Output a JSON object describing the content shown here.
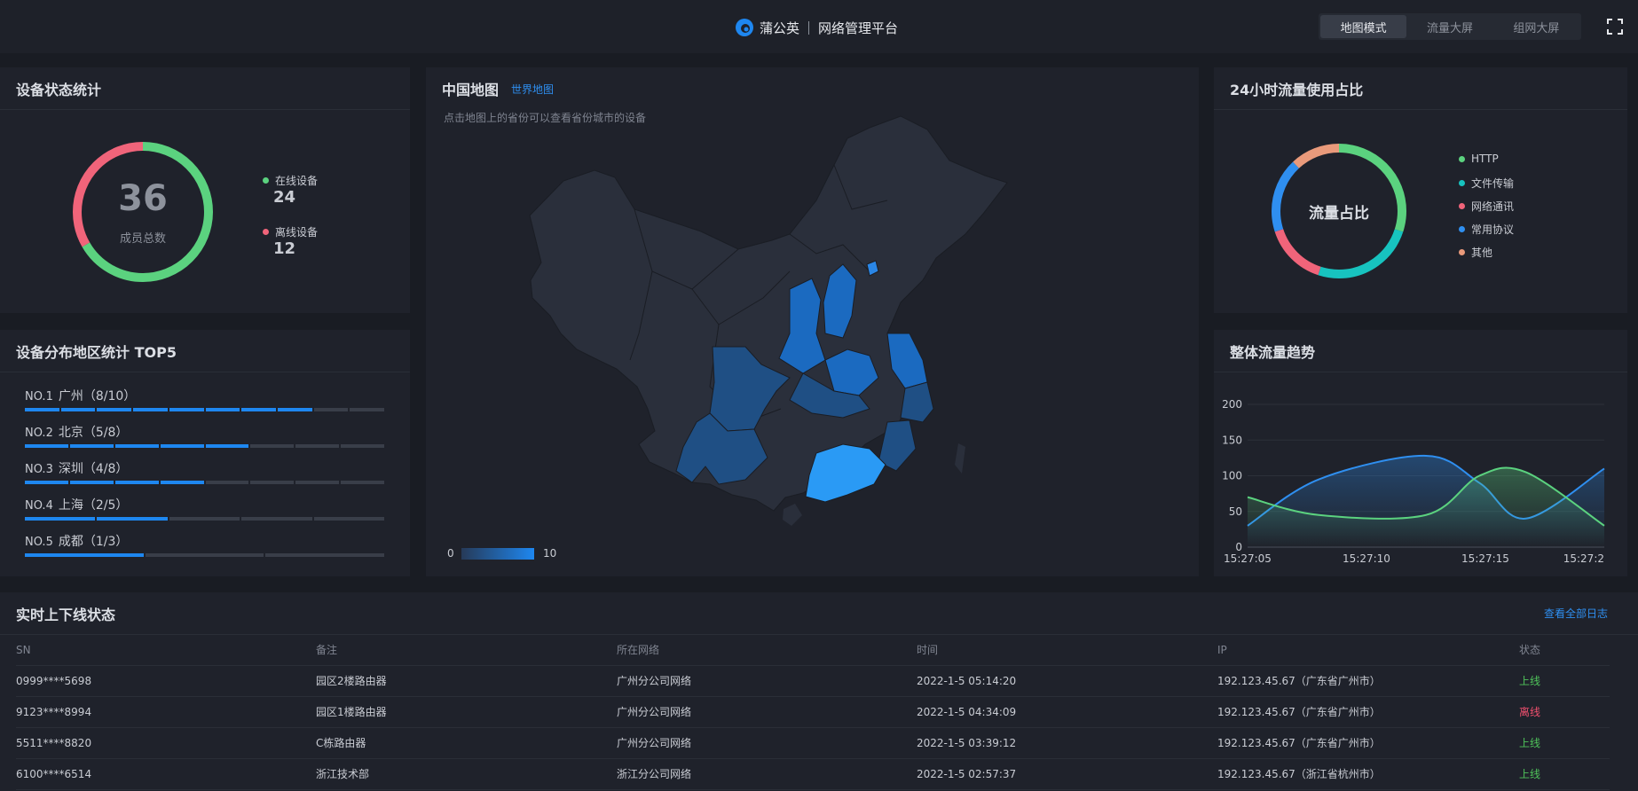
{
  "header": {
    "brand_name": "蒲公英",
    "platform_name": "网络管理平台",
    "modes": [
      "地图模式",
      "流量大屏",
      "组网大屏"
    ],
    "active_mode": "地图模式",
    "accent_color": "#1e87f0"
  },
  "device_status": {
    "title": "设备状态统计",
    "total": "36",
    "total_label": "成员总数",
    "online_label": "在线设备",
    "online_value": "24",
    "offline_label": "离线设备",
    "offline_value": "12",
    "colors": {
      "online": "#5bd27f",
      "offline": "#f0647a"
    }
  },
  "top5": {
    "title": "设备分布地区统计 TOP5",
    "items": [
      {
        "no": "NO.1",
        "label": "广州（8/10）",
        "value": 8,
        "max": 10
      },
      {
        "no": "NO.2",
        "label": "北京（5/8）",
        "value": 5,
        "max": 8
      },
      {
        "no": "NO.3",
        "label": "深圳（4/8）",
        "value": 4,
        "max": 8
      },
      {
        "no": "NO.4",
        "label": "上海（2/5）",
        "value": 2,
        "max": 5
      },
      {
        "no": "NO.5",
        "label": "成都（1/3）",
        "value": 1,
        "max": 3
      }
    ]
  },
  "map": {
    "title": "中国地图",
    "world_link": "世界地图",
    "subtitle": "点击地图上的省份可以查看省份城市的设备",
    "scale_min": "0",
    "scale_max": "10"
  },
  "traffic_share": {
    "title": "24小时流量使用占比",
    "center_label": "流量占比",
    "slices": [
      {
        "name": "HTTP",
        "color": "#5bd27f",
        "share": 0.3
      },
      {
        "name": "文件传输",
        "color": "#17c3bf",
        "share": 0.25
      },
      {
        "name": "网络通讯",
        "color": "#f0647a",
        "share": 0.15
      },
      {
        "name": "常用协议",
        "color": "#2f8ff0",
        "share": 0.18
      },
      {
        "name": "其他",
        "color": "#e99a7b",
        "share": 0.12
      }
    ]
  },
  "trend": {
    "title": "整体流量趋势"
  },
  "chart_data": {
    "type": "area",
    "x": [
      "15:27:05",
      "15:27:10",
      "15:27:15",
      "15:27:2"
    ],
    "ylim": [
      0,
      200
    ],
    "yticks": [
      "200",
      "150",
      "100",
      "50",
      "0"
    ],
    "grid": true,
    "series": [
      {
        "color": "#2f8ff0",
        "x": [
          0,
          0.2,
          0.5,
          0.65,
          0.78,
          1.0
        ],
        "values": [
          30,
          95,
          128,
          90,
          40,
          110
        ]
      },
      {
        "color": "#5bd27f",
        "x": [
          0,
          0.2,
          0.5,
          0.65,
          0.78,
          1.0
        ],
        "values": [
          70,
          45,
          45,
          100,
          105,
          30
        ]
      }
    ]
  },
  "realtime": {
    "title": "实时上下线状态",
    "view_all": "查看全部日志",
    "columns": [
      "SN",
      "备注",
      "所在网络",
      "时间",
      "IP",
      "状态"
    ],
    "rows": [
      [
        "0999****5698",
        "园区2楼路由器",
        "广州分公司网络",
        "2022-1-5 05:14:20",
        "192.123.45.67（广东省广州市）",
        "上线"
      ],
      [
        "9123****8994",
        "园区1楼路由器",
        "广州分公司网络",
        "2022-1-5 04:34:09",
        "192.123.45.67（广东省广州市）",
        "离线"
      ],
      [
        "5511****8820",
        "C栋路由器",
        "广州分公司网络",
        "2022-1-5 03:39:12",
        "192.123.45.67（广东省广州市）",
        "上线"
      ],
      [
        "6100****6514",
        "浙江技术部",
        "浙江分公司网络",
        "2022-1-5 02:57:37",
        "192.123.45.67（浙江省杭州市）",
        "上线"
      ]
    ]
  }
}
